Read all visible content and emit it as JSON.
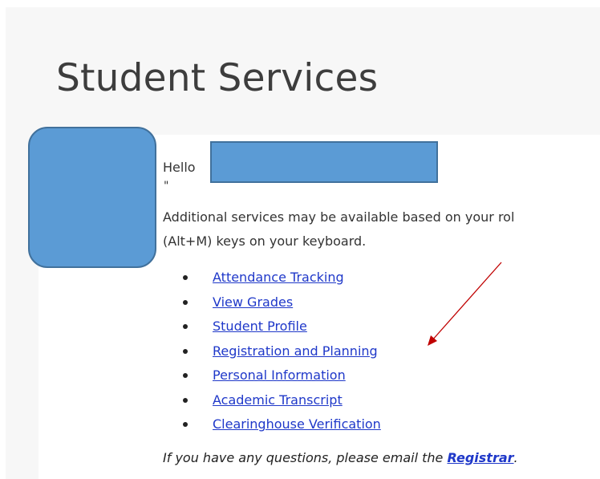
{
  "page": {
    "title": "Student Services"
  },
  "welcome": {
    "greeting": "Hello",
    "quote_mark": "\"",
    "info_line1": "Additional services may be available based on your rol",
    "info_line2": "(Alt+M) keys on your keyboard."
  },
  "services": [
    {
      "label": "Attendance Tracking"
    },
    {
      "label": "View Grades"
    },
    {
      "label": "Student Profile"
    },
    {
      "label": "Registration and Planning"
    },
    {
      "label": "Personal Information"
    },
    {
      "label": "Academic Transcript"
    },
    {
      "label": "Clearinghouse Verification"
    }
  ],
  "footer": {
    "text": "If you have any questions, please email the ",
    "link_label": "Registrar",
    "trailing": "."
  },
  "colors": {
    "redaction_fill": "#5b9bd5",
    "redaction_border": "#41719c",
    "link": "#1f38c9",
    "annotation_arrow": "#c00000"
  },
  "icons": {
    "annotation": "red-arrow-icon"
  }
}
